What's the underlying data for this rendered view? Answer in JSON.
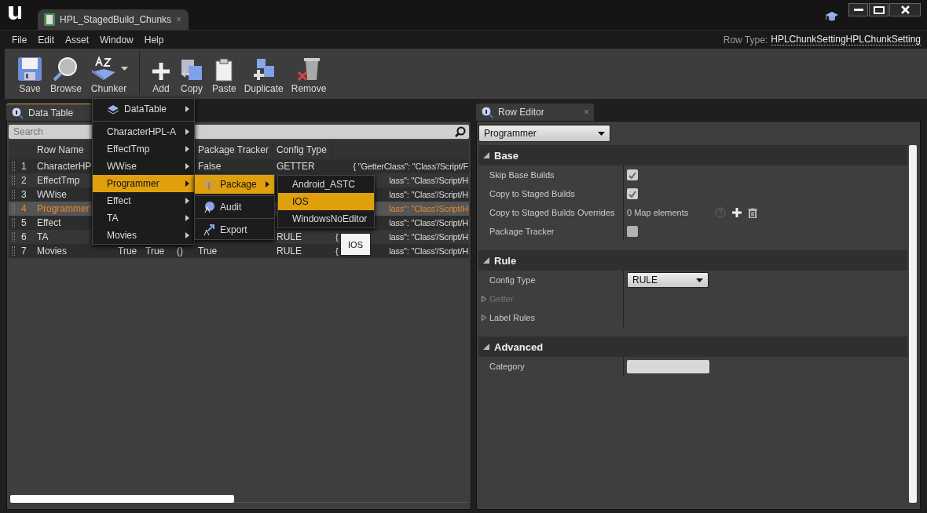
{
  "window": {
    "tab_title": "HPL_StagedBuild_Chunks",
    "close": "×"
  },
  "menu_bar": [
    "File",
    "Edit",
    "Asset",
    "Window",
    "Help"
  ],
  "row_type": {
    "label": "Row Type:",
    "value": "HPLChunkSettingHPLChunkSetting"
  },
  "toolbar": [
    {
      "kind": "save",
      "label": "Save"
    },
    {
      "kind": "browse",
      "label": "Browse"
    },
    {
      "kind": "chunker",
      "label": "Chunker",
      "dropdown": true
    },
    {
      "kind": "separator"
    },
    {
      "kind": "add",
      "label": "Add"
    },
    {
      "kind": "copy",
      "label": "Copy"
    },
    {
      "kind": "paste",
      "label": "Paste"
    },
    {
      "kind": "duplicate",
      "label": "Duplicate"
    },
    {
      "kind": "remove",
      "label": "Remove"
    }
  ],
  "data_table": {
    "tab": "Data Table",
    "search": {
      "placeholder": "Search"
    },
    "columns": {
      "name": "Row Name",
      "tracker": "Package Tracker",
      "config": "Config Type"
    },
    "rows": [
      {
        "index": "1",
        "name": "CharacterHP",
        "tracker": "False",
        "config": "GETTER",
        "data": "{ \"GetterClass\": \"Class'/Script/F",
        "selected": false
      },
      {
        "index": "2",
        "name": "EffectTmp",
        "data": "lass\": \"Class'/Script/H",
        "selected": false
      },
      {
        "index": "3",
        "name": "WWise",
        "data": "lass\": \"Class'/Script/H",
        "selected": false
      },
      {
        "index": "4",
        "name": "Programmer",
        "data": "lass\": \"Class'/Script/H",
        "selected": true
      },
      {
        "index": "5",
        "name": "Effect",
        "data": "lass\": \"Class'/Script/H",
        "selected": false
      },
      {
        "index": "6",
        "name": "TA",
        "config": "RULE",
        "data_lead": "{",
        "data": "lass\": \"Class'/Script/H",
        "selected": false
      },
      {
        "index": "7",
        "name": "Movies",
        "skip": "True",
        "copy": "True",
        "overrides": "()",
        "tracker": "True",
        "config": "RULE",
        "data_lead": "{",
        "data": "lass\": \"Class'/Script/H",
        "selected": false
      }
    ]
  },
  "chunker_menu": [
    {
      "kind": "header",
      "label": "DataTable",
      "selected": false
    },
    {
      "kind": "item",
      "label": "CharacterHPL-A",
      "selected": false
    },
    {
      "kind": "item",
      "label": "EffectTmp",
      "selected": false
    },
    {
      "kind": "item",
      "label": "WWise",
      "selected": false
    },
    {
      "kind": "item",
      "label": "Programmer",
      "selected": true
    },
    {
      "kind": "item",
      "label": "Effect",
      "selected": false
    },
    {
      "kind": "item",
      "label": "TA",
      "selected": false
    },
    {
      "kind": "item",
      "label": "Movies",
      "selected": false
    }
  ],
  "action_menu": [
    {
      "kind": "package",
      "label": "Package",
      "submenu": true,
      "selected": true
    },
    {
      "kind": "audit",
      "label": "Audit",
      "submenu": false,
      "selected": false
    },
    {
      "kind": "export",
      "label": "Export",
      "submenu": false,
      "selected": false
    }
  ],
  "platform_menu": [
    {
      "label": "Android_ASTC",
      "selected": false
    },
    {
      "label": "IOS",
      "selected": true
    },
    {
      "label": "WindowsNoEditor",
      "selected": false
    }
  ],
  "tooltip": "IOS",
  "row_editor": {
    "tab": "Row Editor",
    "close": "×",
    "row_select": "Programmer",
    "categories": [
      {
        "title": "Base",
        "expanded": true,
        "properties": [
          {
            "kind": "checkbox",
            "label": "Skip Base Builds",
            "checked": true
          },
          {
            "kind": "checkbox",
            "label": "Copy to Staged Builds",
            "checked": true
          },
          {
            "kind": "map",
            "label": "Copy to Staged Builds Overrides",
            "value": "0 Map elements"
          },
          {
            "kind": "checkbox",
            "label": "Package Tracker",
            "checked": false
          }
        ]
      },
      {
        "title": "Rule",
        "expanded": true,
        "properties": [
          {
            "kind": "dropdown",
            "label": "Config Type",
            "value": "RULE"
          },
          {
            "kind": "group",
            "label": "Getter",
            "disabled": true
          },
          {
            "kind": "group",
            "label": "Label Rules",
            "disabled": false
          }
        ]
      },
      {
        "title": "Advanced",
        "expanded": true,
        "properties": [
          {
            "kind": "text",
            "label": "Category"
          }
        ]
      }
    ]
  }
}
